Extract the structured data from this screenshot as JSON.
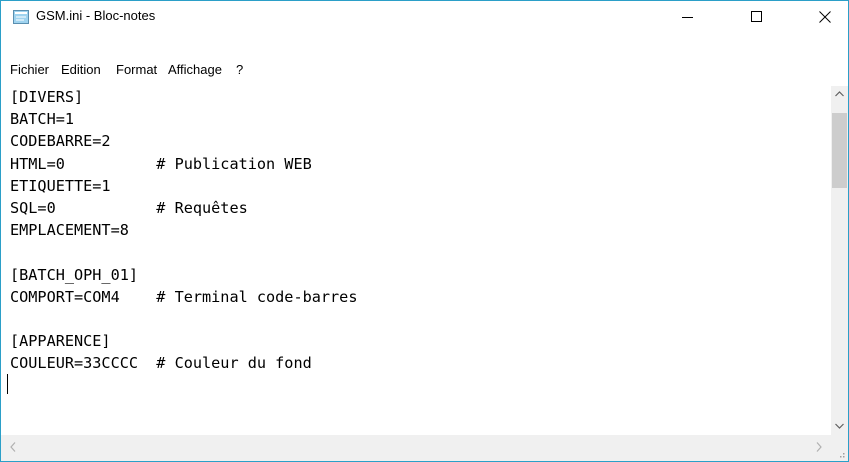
{
  "window": {
    "title": "GSM.ini - Bloc-notes",
    "controls": {
      "minimize": "minimize-icon",
      "maximize": "maximize-icon",
      "close": "close-icon"
    }
  },
  "menu": {
    "items": [
      "Fichier",
      "Edition",
      "Format",
      "Affichage",
      "?"
    ]
  },
  "editor": {
    "lines": [
      "[DIVERS]",
      "BATCH=1",
      "CODEBARRE=2",
      "HTML=0          # Publication WEB",
      "ETIQUETTE=1",
      "SQL=0           # Requêtes",
      "EMPLACEMENT=8",
      "",
      "[BATCH_OPH_01]",
      "COMPORT=COM4    # Terminal code-barres",
      "",
      "[APPARENCE]",
      "COULEUR=33CCCC  # Couleur du fond"
    ]
  },
  "colors": {
    "window_border": "#2b9fc8",
    "scrollbar_track": "#f0f0f0",
    "scrollbar_thumb": "#cdcdcd"
  }
}
